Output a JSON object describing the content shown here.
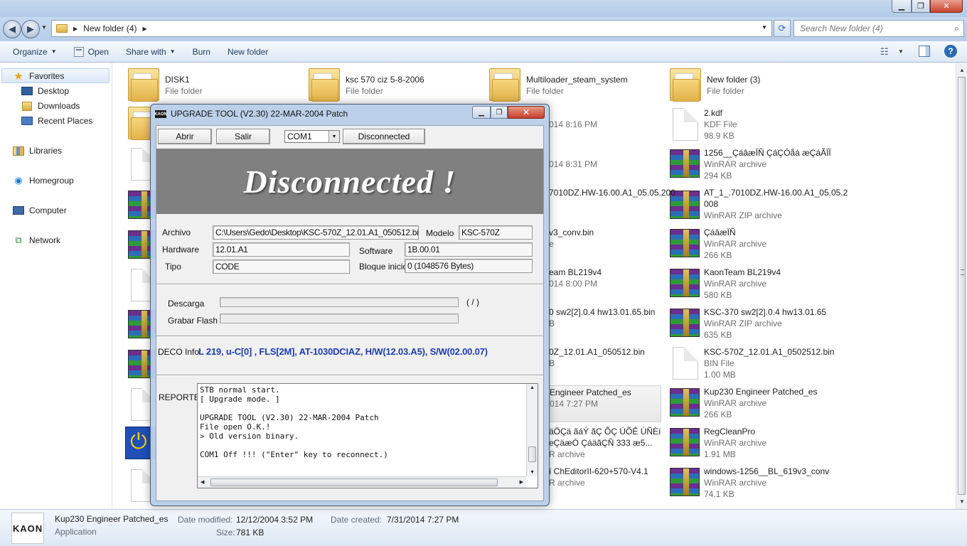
{
  "explorer": {
    "address": {
      "path": "New folder (4)"
    },
    "search": {
      "placeholder": "Search New folder (4)"
    },
    "commands": {
      "organize": "Organize",
      "open": "Open",
      "share_with": "Share with",
      "burn": "Burn",
      "new_folder": "New folder"
    },
    "nav": {
      "favorites": "Favorites",
      "desktop": "Desktop",
      "downloads": "Downloads",
      "recent_places": "Recent Places",
      "libraries": "Libraries",
      "homegroup": "Homegroup",
      "computer": "Computer",
      "network": "Network"
    },
    "files": [
      {
        "name": "DISK1",
        "type": "File folder",
        "icon": "folder-icon"
      },
      {
        "name": "ksc 570 ciz 5-8-2006",
        "type": "File folder",
        "icon": "folder-icon"
      },
      {
        "name": "Multiloader_steam_system",
        "type": "File folder",
        "icon": "folder-icon"
      },
      {
        "name": "New folder (3)",
        "type": "File folder",
        "icon": "folder-icon"
      },
      {
        "name": "2.kdf",
        "type": "KDF File",
        "size": "98.9 KB",
        "icon": "document-icon"
      },
      {
        "name": "1256__ÇáâæÏÑ ÇáÇÓåá æÇáÃÏÏ",
        "type": "WinRAR archive",
        "size": "294 KB",
        "icon": "winrar-icon"
      },
      {
        "name": "AT_1_.7010DZ.HW-16.00.A1_05.05.2",
        "name2": "008",
        "type": "WinRAR ZIP archive",
        "icon": "winrar-icon"
      },
      {
        "name": "ÇáâæÏÑ",
        "type": "WinRAR archive",
        "size": "266 KB",
        "icon": "winrar-icon"
      },
      {
        "name": "KaonTeam BL219v4",
        "type": "WinRAR archive",
        "size": "580 KB",
        "icon": "winrar-icon"
      },
      {
        "name": "KSC-370 sw2[2].0.4 hw13.01.65",
        "type": "WinRAR ZIP archive",
        "size": "635 KB",
        "icon": "winrar-icon"
      },
      {
        "name": "KSC-570Z_12.01.A1_0502512.bin",
        "type": "BIN File",
        "size": "1.00 MB",
        "icon": "document-icon"
      },
      {
        "name": "Kup230 Engineer Patched_es",
        "type": "WinRAR archive",
        "size": "266 KB",
        "icon": "winrar-icon"
      },
      {
        "name": "RegCleanPro",
        "type": "WinRAR archive",
        "size": "1.91 MB",
        "icon": "winrar-icon"
      },
      {
        "name": "windows-1256__BL_619v3_conv",
        "type": "WinRAR archive",
        "size": "74.1 KB",
        "icon": "winrar-icon"
      }
    ],
    "partial_files": [
      {
        "name": "014 8:16 PM"
      },
      {
        "name": "014 8:31 PM"
      },
      {
        "name": "7010DZ.HW-16.00.A1_05.05.200"
      },
      {
        "name": "v3_conv.bin",
        "sub": "e"
      },
      {
        "name": "eam BL219v4",
        "sub": "014 8:00 PM"
      },
      {
        "name": "0 sw2[2].0.4 hw13.01.65.bin",
        "sub": "B"
      },
      {
        "name": "0Z_12.01.A1_050512.bin",
        "sub": "B"
      },
      {
        "name": "Engineer Patched_es",
        "sub": "014 7:27 PM"
      },
      {
        "name": "äÖÇä ãáÝ ãÇ ÕÇ ÚÕÊ ÚÑÈí",
        "name2": "eÇäæÓ ÇáäãÇÑ 333 æ5...",
        "sub": "R archive"
      },
      {
        "name": "í ChEditorII-620+570-V4.1",
        "sub": "R archive"
      }
    ],
    "details": {
      "name": "Kup230 Engineer Patched_es",
      "type": "Application",
      "date_modified_label": "Date modified:",
      "date_modified": "12/12/2004 3:52 PM",
      "date_created_label": "Date created:",
      "date_created": "7/31/2014 7:27 PM",
      "size_label": "Size:",
      "size": "781 KB",
      "icon_text": "KAON"
    }
  },
  "dialog": {
    "title": "UPGRADE TOOL (V2.30) 22-MAR-2004 Patch",
    "icon_text": "KAON",
    "buttons": {
      "abrir": "Abrir",
      "salir": "Salir",
      "status": "Disconnected"
    },
    "com_port": "COM1",
    "banner": "Disconnected !",
    "fields": {
      "archivo_label": "Archivo",
      "archivo": "C:\\Users\\Gedo\\Desktop\\KSC-570Z_12.01.A1_050512.bin",
      "modelo_label": "Modelo",
      "modelo": "KSC-570Z",
      "hardware_label": "Hardware",
      "hardware": "12.01.A1",
      "software_label": "Software",
      "software": "1B.00.01",
      "tipo_label": "Tipo",
      "tipo": "CODE",
      "bloque_label": "Bloque inicio",
      "bloque": "0  (1048576 Bytes)"
    },
    "progress": {
      "descarga_label": "Descarga",
      "descarga_value": 0,
      "descarga_ratio": "(  /  )",
      "grabar_label": "Grabar Flash",
      "grabar_value": 0
    },
    "deco": {
      "label": "DECO Info:",
      "value": "L 219, u-C[0] , FLS[2M], AT-1030DCIAZ, H/W(12.03.A5), S/W(02.00.07)"
    },
    "reporte": {
      "label": "REPORTE",
      "lines": "STB normal start.\n[ Upgrade mode. ]\n\nUPGRADE TOOL (V2.30) 22-MAR-2004 Patch\nFile open O.K.!\n> Old version binary.\n\nCOM1 Off !!! (\"Enter\" key to reconnect.)"
    }
  }
}
